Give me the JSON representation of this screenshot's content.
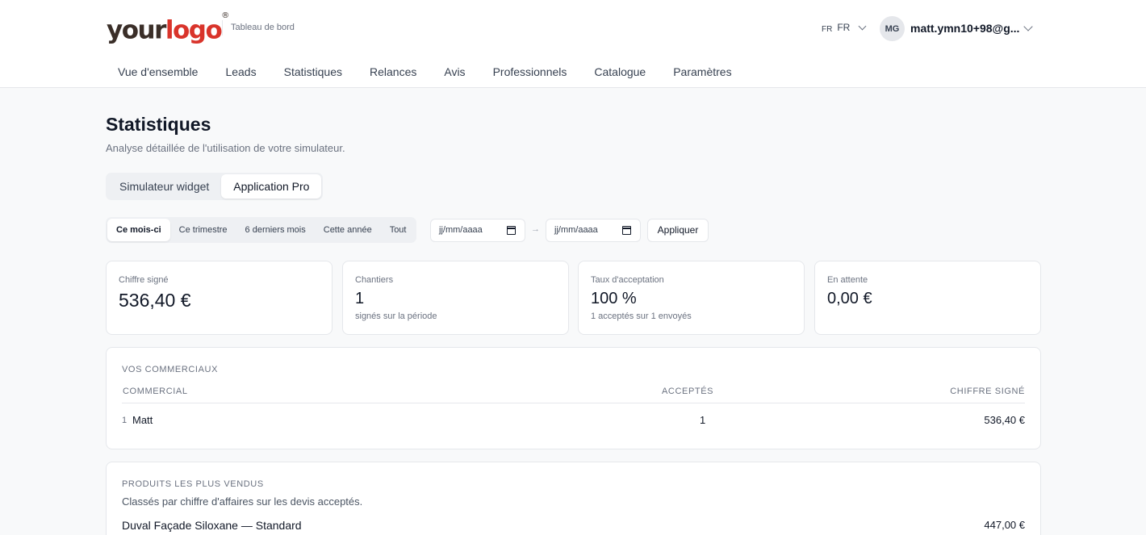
{
  "brand": {
    "logo_your": "your",
    "logo_logo": "logo",
    "logo_reg": "®",
    "section": "Tableau de bord"
  },
  "header": {
    "lang_flag": "FR",
    "lang_code": "FR",
    "avatar_initials": "MG",
    "user_email": "matt.ymn10+98@g..."
  },
  "nav": {
    "items": [
      "Vue d'ensemble",
      "Leads",
      "Statistiques",
      "Relances",
      "Avis",
      "Professionnels",
      "Catalogue",
      "Paramètres"
    ]
  },
  "page": {
    "title": "Statistiques",
    "subtitle": "Analyse détaillée de l'utilisation de votre simulateur."
  },
  "tabs": {
    "simulateur": "Simulateur widget",
    "application": "Application Pro"
  },
  "period": {
    "options": [
      "Ce mois-ci",
      "Ce trimestre",
      "6 derniers mois",
      "Cette année",
      "Tout"
    ],
    "date_from_placeholder": "jj/mm/aaaa",
    "date_to_placeholder": "jj/mm/aaaa",
    "separator": "→",
    "apply_label": "Appliquer"
  },
  "kpis": [
    {
      "label": "Chiffre signé",
      "value": "536,40 €",
      "note": ""
    },
    {
      "label": "Chantiers",
      "value": "1",
      "note": "signés sur la période"
    },
    {
      "label": "Taux d'acceptation",
      "value": "100 %",
      "note": "1 acceptés sur 1 envoyés"
    },
    {
      "label": "En attente",
      "value": "0,00 €",
      "note": ""
    }
  ],
  "commerciaux": {
    "title": "VOS COMMERCIAUX",
    "columns": [
      "COMMERCIAL",
      "ACCEPTÉS",
      "CHIFFRE SIGNÉ"
    ],
    "rows": [
      {
        "rank": "1",
        "name": "Matt",
        "acceptes": "1",
        "chiffre": "536,40 €"
      }
    ]
  },
  "produits": {
    "title": "PRODUITS LES PLUS VENDUS",
    "subtitle": "Classés par chiffre d'affaires sur les devis acceptés.",
    "rows": [
      {
        "name": "Duval Façade Siloxane — Standard",
        "value": "447,00 €"
      }
    ]
  }
}
